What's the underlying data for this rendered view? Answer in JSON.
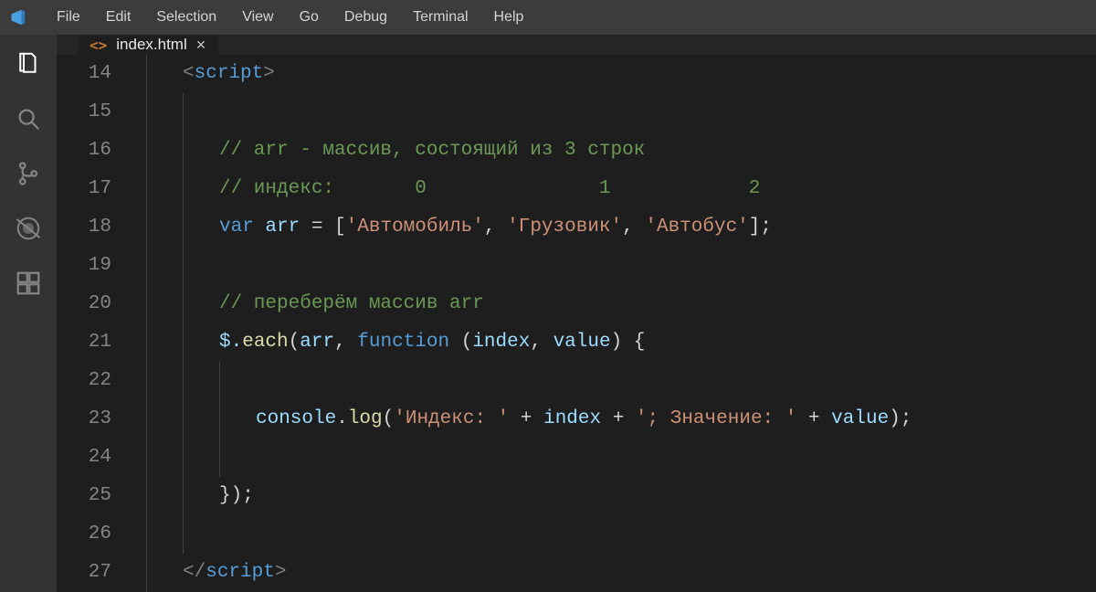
{
  "menu": {
    "items": [
      "File",
      "Edit",
      "Selection",
      "View",
      "Go",
      "Debug",
      "Terminal",
      "Help"
    ]
  },
  "activity": {
    "icons": [
      "files-icon",
      "search-icon",
      "source-control-icon",
      "debug-icon",
      "extensions-icon"
    ]
  },
  "tab": {
    "icon_label": "<>",
    "filename": "index.html",
    "close": "×"
  },
  "gutter": {
    "start": 14,
    "end": 27
  },
  "code": {
    "l14": {
      "open": "<",
      "tag": "script",
      "close": ">"
    },
    "l16": {
      "comment": "// arr - массив, состоящий из 3 строк"
    },
    "l17": {
      "comment": "// индекс:       0               1            2"
    },
    "l18": {
      "kw": "var",
      "name": "arr",
      "eq": " = [",
      "s1": "'Автомобиль'",
      "c1": ", ",
      "s2": "'Грузовик'",
      "c2": ", ",
      "s3": "'Автобус'",
      "end": "];"
    },
    "l20": {
      "comment": "// переберём массив arr"
    },
    "l21": {
      "dollar": "$.",
      "each": "each",
      "open": "(",
      "arr": "arr",
      "comma": ", ",
      "fn": "function",
      "args": " (",
      "p1": "index",
      "c2": ", ",
      "p2": "value",
      "close": ") {"
    },
    "l23": {
      "console": "console",
      "dot": ".",
      "log": "log",
      "open": "(",
      "s1": "'Индекс: '",
      "p1": " + ",
      "v1": "index",
      "p2": " + ",
      "s2": "'; Значение: '",
      "p3": " + ",
      "v2": "value",
      "close": ");"
    },
    "l25": {
      "brace": "});"
    },
    "l27": {
      "open": "</",
      "tag": "script",
      "close": ">"
    }
  }
}
